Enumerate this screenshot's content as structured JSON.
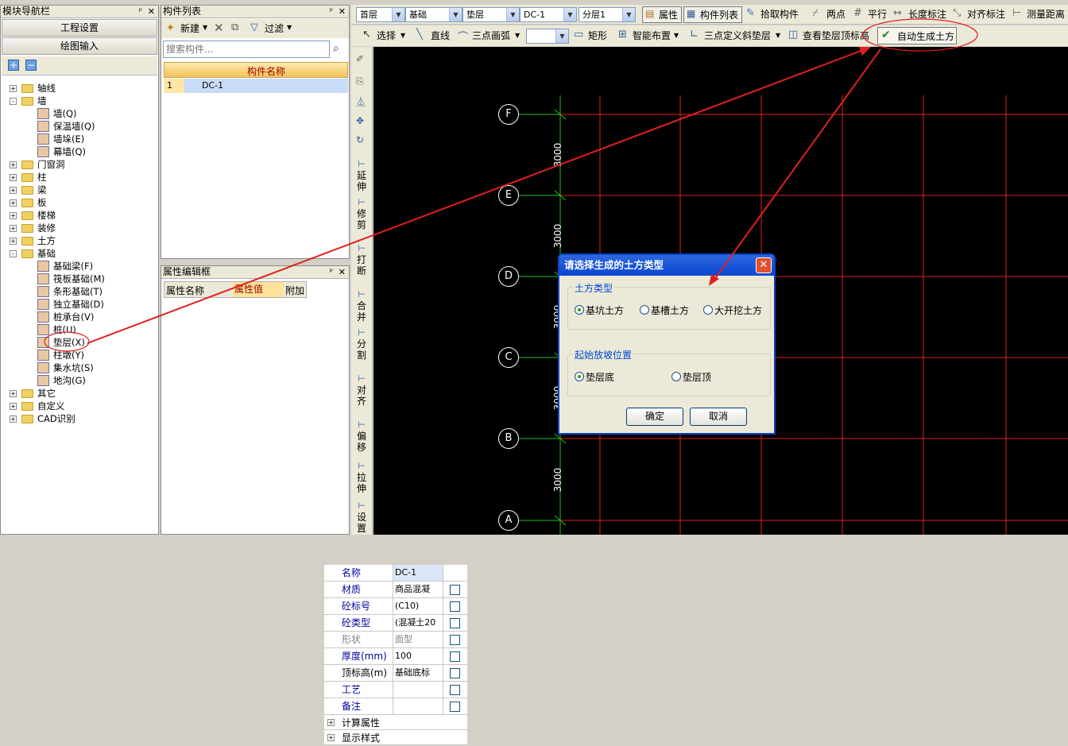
{
  "nav": {
    "title": "模块导航栏",
    "pin": "ᵖ",
    "close": "×",
    "buttons": [
      "工程设置",
      "绘图输入"
    ],
    "tree": [
      {
        "label": "轴线",
        "level": 0,
        "exp": "+",
        "type": "folder"
      },
      {
        "label": "墙",
        "level": 0,
        "exp": "-",
        "type": "folder"
      },
      {
        "label": "墙(Q)",
        "level": 1,
        "type": "comp"
      },
      {
        "label": "保温墙(Q)",
        "level": 1,
        "type": "comp"
      },
      {
        "label": "墙垛(E)",
        "level": 1,
        "type": "comp"
      },
      {
        "label": "幕墙(Q)",
        "level": 1,
        "type": "comp"
      },
      {
        "label": "门窗洞",
        "level": 0,
        "exp": "+",
        "type": "folder"
      },
      {
        "label": "柱",
        "level": 0,
        "exp": "+",
        "type": "folder"
      },
      {
        "label": "梁",
        "level": 0,
        "exp": "+",
        "type": "folder"
      },
      {
        "label": "板",
        "level": 0,
        "exp": "+",
        "type": "folder"
      },
      {
        "label": "楼梯",
        "level": 0,
        "exp": "+",
        "type": "folder"
      },
      {
        "label": "装修",
        "level": 0,
        "exp": "+",
        "type": "folder"
      },
      {
        "label": "土方",
        "level": 0,
        "exp": "+",
        "type": "folder"
      },
      {
        "label": "基础",
        "level": 0,
        "exp": "-",
        "type": "folder"
      },
      {
        "label": "基础梁(F)",
        "level": 1,
        "type": "comp"
      },
      {
        "label": "筏板基础(M)",
        "level": 1,
        "type": "comp"
      },
      {
        "label": "条形基础(T)",
        "level": 1,
        "type": "comp"
      },
      {
        "label": "独立基础(D)",
        "level": 1,
        "type": "comp"
      },
      {
        "label": "桩承台(V)",
        "level": 1,
        "type": "comp"
      },
      {
        "label": "桩(U)",
        "level": 1,
        "type": "comp"
      },
      {
        "label": "垫层(X)",
        "level": 1,
        "type": "comp"
      },
      {
        "label": "柱墩(Y)",
        "level": 1,
        "type": "comp"
      },
      {
        "label": "集水坑(S)",
        "level": 1,
        "type": "comp"
      },
      {
        "label": "地沟(G)",
        "level": 1,
        "type": "comp"
      },
      {
        "label": "其它",
        "level": 0,
        "exp": "+",
        "type": "folder"
      },
      {
        "label": "自定义",
        "level": 0,
        "exp": "+",
        "type": "folder"
      },
      {
        "label": "CAD识别",
        "level": 0,
        "exp": "+",
        "type": "folder"
      }
    ]
  },
  "comp": {
    "title": "构件列表",
    "new": "新建",
    "filter": "过滤",
    "search_placeholder": "搜索构件...",
    "col": "构件名称",
    "rows": [
      {
        "idx": "1",
        "name": "DC-1"
      }
    ]
  },
  "prop": {
    "title": "属性编辑框",
    "h1": "属性名称",
    "h2": "属性值",
    "h3": "附加",
    "rows": [
      {
        "name": "名称",
        "value": "DC-1",
        "cb": false,
        "color": "#0000a0"
      },
      {
        "name": "材质",
        "value": "商品混凝",
        "cb": true,
        "color": "#0000a0"
      },
      {
        "name": "砼标号",
        "value": "(C10)",
        "cb": true,
        "color": "#0000a0"
      },
      {
        "name": "砼类型",
        "value": "(混凝土20",
        "cb": true,
        "color": "#0000a0"
      },
      {
        "name": "形状",
        "value": "面型",
        "cb": true,
        "color": "#808080"
      },
      {
        "name": "厚度(mm)",
        "value": "100",
        "cb": true,
        "color": "#0000a0"
      },
      {
        "name": "顶标高(m)",
        "value": "基础底标",
        "cb": true,
        "color": "#000"
      },
      {
        "name": "工艺",
        "value": "",
        "cb": true,
        "color": "#0000a0"
      },
      {
        "name": "备注",
        "value": "",
        "cb": true,
        "color": "#0000a0"
      }
    ],
    "groups": [
      "计算属性",
      "显示样式"
    ]
  },
  "toolbar1": {
    "floor": "首层",
    "cat": "基础",
    "sub": "垫层",
    "comp": "DC-1",
    "layer": "分层1",
    "attr": "属性",
    "complist": "构件列表",
    "pick": "拾取构件",
    "twopoint": "两点",
    "parallel": "平行",
    "lenmark": "长度标注",
    "alignmark": "对齐标注",
    "measure": "测量距离"
  },
  "toolbar2": {
    "select": "选择",
    "line": "直线",
    "arc": "三点画弧",
    "rect": "矩形",
    "smart": "智能布置",
    "slope": "三点定义斜垫层",
    "viewtop": "查看垫层顶标高",
    "auto": "自动生成土方"
  },
  "vtools": [
    "延伸",
    "修剪",
    "打断",
    "合并",
    "分割",
    "对齐",
    "偏移",
    "拉伸",
    "设置"
  ],
  "canvas": {
    "axes": [
      "F",
      "E",
      "D",
      "C",
      "B",
      "A"
    ],
    "dims": [
      "3000",
      "3000",
      "3000",
      "3000",
      "3000"
    ]
  },
  "dialog": {
    "title": "请选择生成的土方类型",
    "g1": "土方类型",
    "opt1": [
      "基坑土方",
      "基槽土方",
      "大开挖土方"
    ],
    "g2": "起始放坡位置",
    "opt2": [
      "垫层底",
      "垫层顶"
    ],
    "ok": "确定",
    "cancel": "取消"
  }
}
